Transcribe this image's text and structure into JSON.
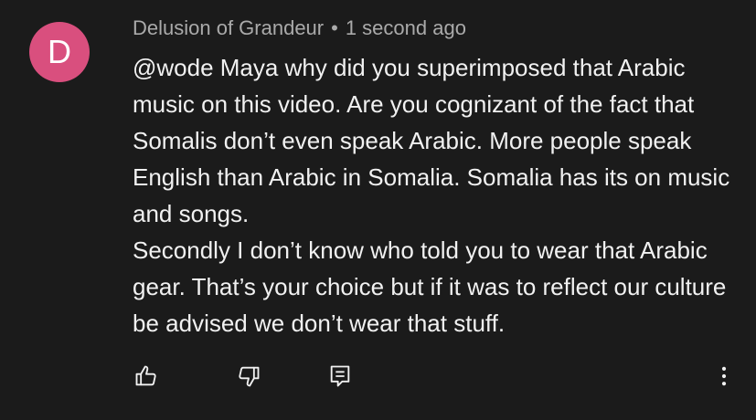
{
  "comment": {
    "avatar_letter": "D",
    "avatar_color": "#d94f7e",
    "author": "Delusion of Grandeur",
    "separator": "•",
    "timestamp": "1 second ago",
    "paragraph_1": "@wode Maya why did you superimposed that Arabic music on this video. Are you cognizant of the fact that Somalis don’t even speak Arabic. More people speak English than Arabic in Somalia. Somalia has its on music and songs.",
    "paragraph_2": "Secondly I don’t know who told you to wear that Arabic gear. That’s your choice but if it was to reflect our culture be advised we don’t wear that stuff."
  },
  "actions": {
    "like_icon": "thumbs-up-icon",
    "dislike_icon": "thumbs-down-icon",
    "reply_icon": "reply-icon",
    "more_icon": "more-vertical-icon"
  },
  "colors": {
    "background": "#1b1b1b",
    "text": "#f1f1f1",
    "meta_text": "#aaaaaa"
  }
}
